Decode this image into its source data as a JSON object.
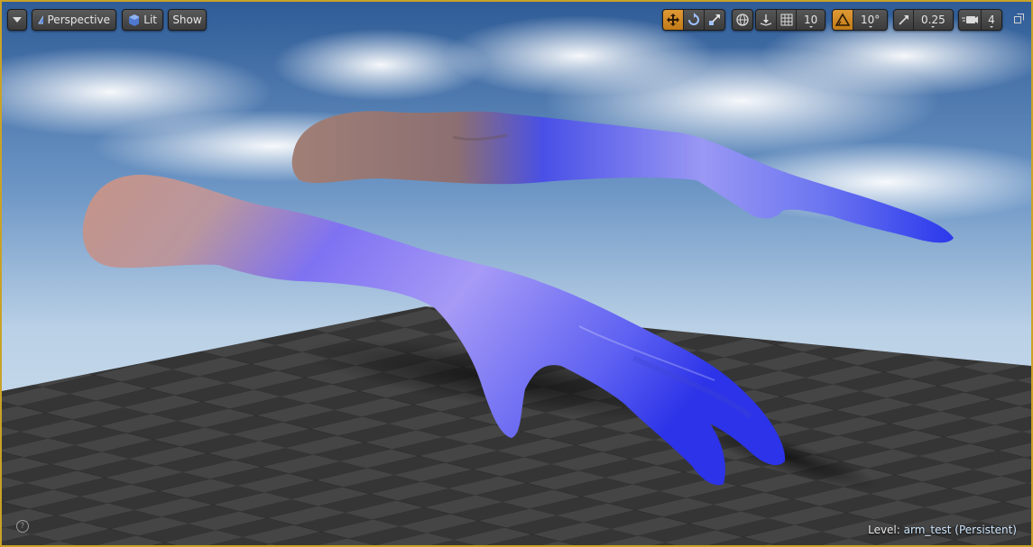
{
  "toolbar": {
    "menu_dropdown": "",
    "view_mode_label": "Perspective",
    "lighting_label": "Lit",
    "show_label": "Show"
  },
  "transform": {
    "grid_snap_value": "10",
    "rotation_snap_value": "10°",
    "scale_snap_value": "0.25",
    "camera_speed_value": "4"
  },
  "status": {
    "level_prefix": "Level:",
    "level_name": "arm_test (Persistent)"
  },
  "colors": {
    "frame_border": "#c9a227",
    "active_tool": "#e09a35",
    "arm_blue": "#3d4cf0",
    "arm_lavender": "#a79cff",
    "arm_skin": "#c79a8c"
  },
  "icons": [
    "chevron-down-icon",
    "perspective-icon",
    "lit-sphere-icon",
    "translate-icon",
    "rotate-icon",
    "scale-icon",
    "world-icon",
    "surface-snap-icon",
    "grid-icon",
    "rotation-snap-icon",
    "scale-snap-icon",
    "camera-speed-icon",
    "maximize-icon",
    "help-icon"
  ]
}
